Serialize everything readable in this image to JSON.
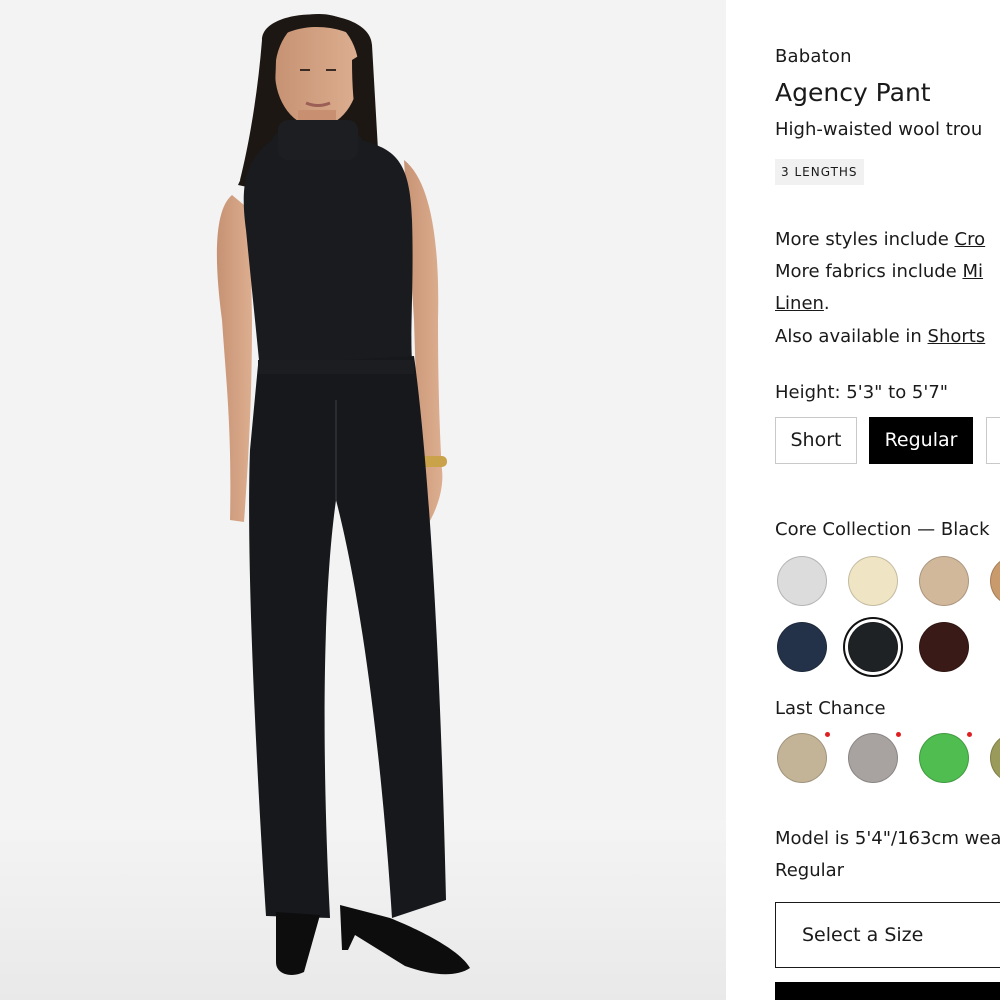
{
  "product": {
    "brand": "Babaton",
    "title": "Agency Pant",
    "subtitle": "High-waisted wool trou",
    "badge": "3 LENGTHS"
  },
  "more": {
    "styles_prefix": "More styles include ",
    "styles_link": "Cro",
    "fabrics_prefix": "More fabrics include ",
    "fabrics_link": "Mi",
    "fabrics_link_2": "Linen",
    "fabrics_end": ".",
    "also_prefix": "Also available in ",
    "also_link": "Shorts"
  },
  "height": {
    "label": "Height: 5'3\" to 5'7\"",
    "options": [
      "Short",
      "Regular",
      ""
    ],
    "selected": "Regular"
  },
  "core_collection": {
    "label": "Core Collection — Black",
    "swatches": [
      {
        "name": "light-grey",
        "color": "#dcdcdc"
      },
      {
        "name": "cream",
        "color": "#efe4c4"
      },
      {
        "name": "tan",
        "color": "#d2b89b"
      },
      {
        "name": "camel",
        "color": "#c99a6c"
      },
      {
        "name": "navy",
        "color": "#243249"
      },
      {
        "name": "black",
        "color": "#1f2224",
        "selected": true
      },
      {
        "name": "dark-brown",
        "color": "#3a1a16"
      }
    ]
  },
  "last_chance": {
    "label": "Last Chance",
    "swatches": [
      {
        "name": "khaki",
        "color": "#c4b497"
      },
      {
        "name": "grey",
        "color": "#a8a3a0"
      },
      {
        "name": "green",
        "color": "#4fbd4f"
      },
      {
        "name": "olive",
        "color": "#9a9a5a"
      }
    ]
  },
  "model": {
    "note": "Model is 5'4\"/163cm wea",
    "length": "Regular"
  },
  "size_select": {
    "placeholder": "Select a Size"
  }
}
